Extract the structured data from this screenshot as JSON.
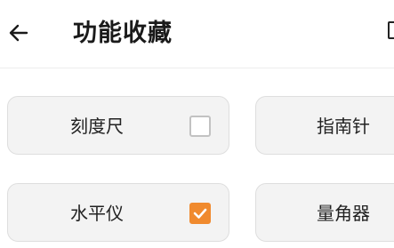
{
  "header": {
    "title": "功能收藏",
    "back_icon": "arrow-left-icon",
    "more_icon": "square-icon"
  },
  "tools": [
    {
      "label": "刻度尺",
      "checked": false
    },
    {
      "label": "指南针"
    },
    {
      "label": "水平仪",
      "checked": true
    },
    {
      "label": "量角器"
    }
  ],
  "colors": {
    "accent": "#f08a2e",
    "card_bg": "#f3f3f3",
    "checkbox_border": "#c2c2c2"
  }
}
